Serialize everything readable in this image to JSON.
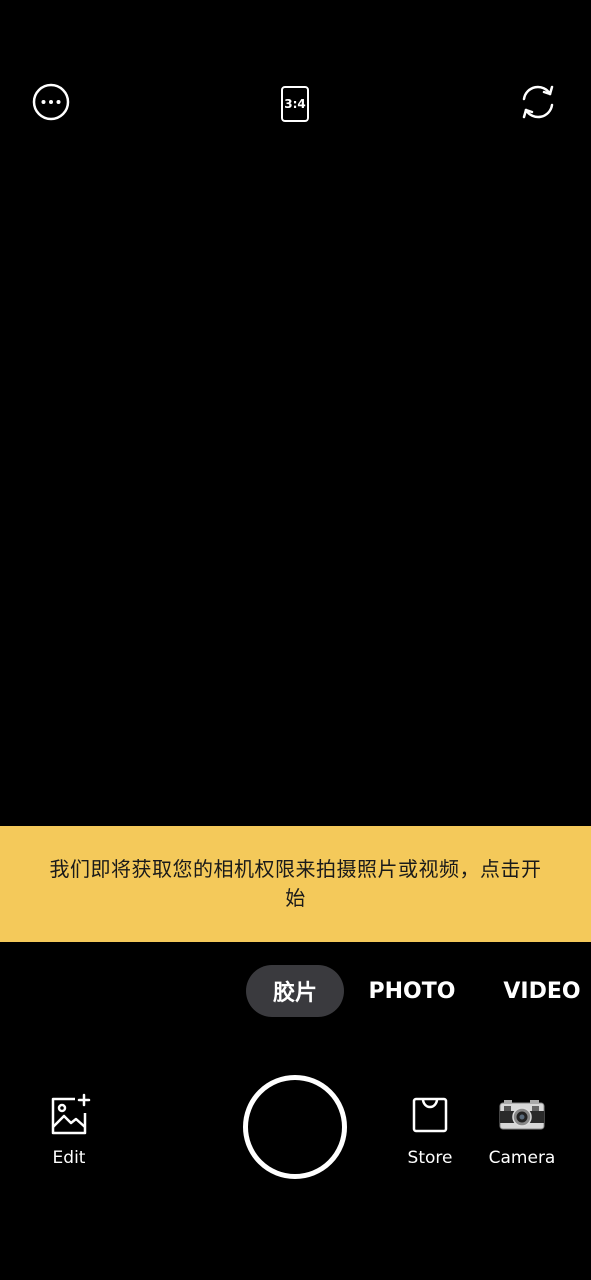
{
  "top_bar": {
    "ratio_label": "3:4",
    "icons": [
      "more-icon",
      "aspect-ratio-icon",
      "flip-camera-icon"
    ]
  },
  "banner": {
    "text": "我们即将获取您的相机权限来拍摄照片或视频，点击开始",
    "background": "#f4c95a"
  },
  "modes": {
    "items": [
      {
        "label": "胶片",
        "active": true
      },
      {
        "label": "PHOTO",
        "active": false
      },
      {
        "label": "VIDEO",
        "active": false
      }
    ]
  },
  "bottom_bar": {
    "edit_label": "Edit",
    "store_label": "Store",
    "camera_label": "Camera",
    "icons": [
      "edit-image-icon",
      "shutter-button",
      "shopping-bag-icon",
      "vintage-camera-icon"
    ]
  }
}
